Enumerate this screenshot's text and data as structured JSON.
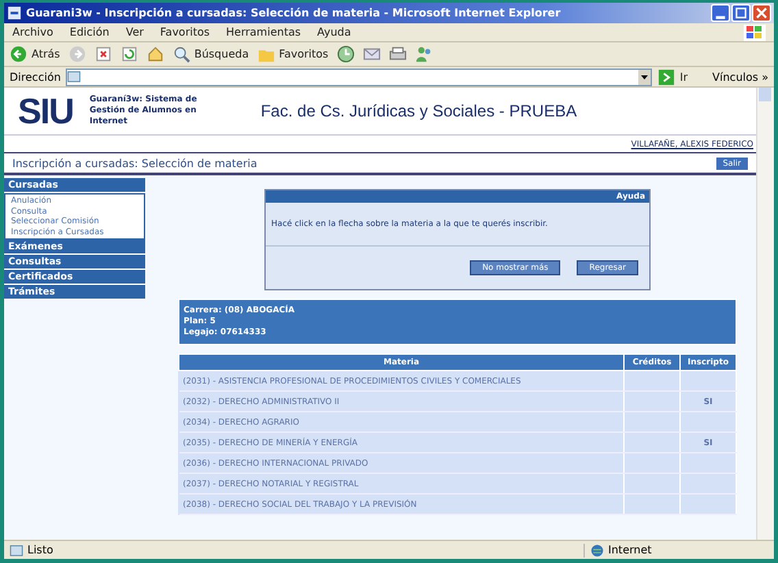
{
  "window": {
    "title": "Guarani3w - Inscripción a cursadas: Selección de materia - Microsoft Internet Explorer"
  },
  "menu": [
    "Archivo",
    "Edición",
    "Ver",
    "Favoritos",
    "Herramientas",
    "Ayuda"
  ],
  "toolbar": {
    "back": "Atrás",
    "search": "Búsqueda",
    "favorites": "Favoritos"
  },
  "address": {
    "label": "Dirección",
    "go": "Ir",
    "links": "Vínculos »"
  },
  "header": {
    "logo": "SIU",
    "system": "Guaraní3w: Sistema de Gestión de Alumnos en Internet",
    "faculty": "Fac. de Cs. Jurídicas y Sociales - PRUEBA",
    "user": "VILLAFAÑE, ALEXIS FEDERICO"
  },
  "page_title": "Inscripción a cursadas: Selección de materia",
  "exit": "Salir",
  "sidebar": [
    {
      "label": "Cursadas",
      "children": [
        {
          "label": "Anulación"
        },
        {
          "label": "Consulta"
        },
        {
          "label": "Seleccionar Comisión"
        },
        {
          "label": "Inscripción a Cursadas"
        }
      ]
    },
    {
      "label": "Exámenes"
    },
    {
      "label": "Consultas"
    },
    {
      "label": "Certificados"
    },
    {
      "label": "Trámites"
    }
  ],
  "dialog": {
    "title": "Ayuda",
    "message": "Hacé click en la flecha sobre la materia a la que te querés inscribir.",
    "buttons": [
      "No mostrar más",
      "Regresar"
    ]
  },
  "info": [
    "Carrera: (08) ABOGACÍA",
    "Plan: 5",
    "Legajo: 07614333"
  ],
  "table": {
    "columns": [
      "Materia",
      "Créditos",
      "Inscripto"
    ],
    "rows": [
      {
        "materia": "(2031) - ASISTENCIA PROFESIONAL DE PROCEDIMIENTOS CIVILES Y COMERCIALES"
      },
      {
        "materia": "(2032) - DERECHO ADMINISTRATIVO II",
        "inscripto": "SI"
      },
      {
        "materia": "(2034) - DERECHO AGRARIO"
      },
      {
        "materia": "(2035) - DERECHO DE MINERÍA Y ENERGÍA",
        "inscripto": "SI"
      },
      {
        "materia": "(2036) - DERECHO INTERNACIONAL PRIVADO"
      },
      {
        "materia": "(2037) - DERECHO NOTARIAL Y REGISTRAL"
      },
      {
        "materia": "(2038) - DERECHO SOCIAL DEL TRABAJO Y LA PREVISIÓN"
      }
    ]
  },
  "status_bar": {
    "text": "Listo",
    "zone": "Internet"
  }
}
